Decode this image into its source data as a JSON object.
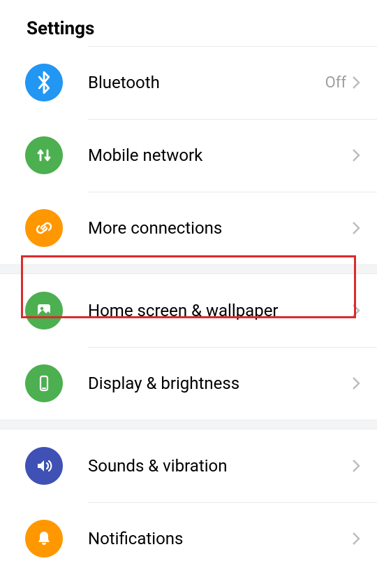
{
  "title": "Settings",
  "rows": {
    "bluetooth": {
      "label": "Bluetooth",
      "value": "Off"
    },
    "mobile": {
      "label": "Mobile network"
    },
    "more": {
      "label": "More connections"
    },
    "home": {
      "label": "Home screen & wallpaper"
    },
    "display": {
      "label": "Display & brightness"
    },
    "sounds": {
      "label": "Sounds & vibration"
    },
    "notif": {
      "label": "Notifications"
    }
  }
}
